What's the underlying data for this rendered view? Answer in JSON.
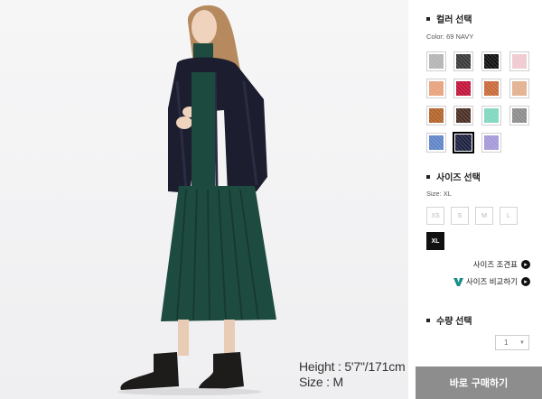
{
  "photo": {
    "caption_height": "Height : 5'7\"/171cm",
    "caption_size": "Size : M"
  },
  "color_section": {
    "title": "컬러 선택",
    "selected_label": "Color: 69 NAVY",
    "swatches": [
      {
        "name": "light-gray",
        "color": "#b4b4b4",
        "selected": false
      },
      {
        "name": "dark-gray",
        "color": "#3a3a3a",
        "selected": false
      },
      {
        "name": "black",
        "color": "#111111",
        "selected": false
      },
      {
        "name": "light-pink",
        "color": "#f0c9cf",
        "selected": false
      },
      {
        "name": "peach",
        "color": "#e7a27c",
        "selected": false
      },
      {
        "name": "red",
        "color": "#c2143a",
        "selected": false
      },
      {
        "name": "orange-brown",
        "color": "#c86a3a",
        "selected": false
      },
      {
        "name": "beige",
        "color": "#e2b08e",
        "selected": false
      },
      {
        "name": "brown",
        "color": "#b2642a",
        "selected": false
      },
      {
        "name": "dark-brown",
        "color": "#4a2f24",
        "selected": false
      },
      {
        "name": "mint",
        "color": "#7fd7be",
        "selected": false
      },
      {
        "name": "gray",
        "color": "#8c8c8c",
        "selected": false
      },
      {
        "name": "blue",
        "color": "#5f85c8",
        "selected": false
      },
      {
        "name": "navy",
        "color": "#1d2140",
        "selected": true
      },
      {
        "name": "lavender",
        "color": "#a598d8",
        "selected": false
      }
    ]
  },
  "size_section": {
    "title": "사이즈 선택",
    "selected_label": "Size: XL",
    "sizes": [
      {
        "label": "XS",
        "active": false
      },
      {
        "label": "S",
        "active": false
      },
      {
        "label": "M",
        "active": false
      },
      {
        "label": "L",
        "active": false
      },
      {
        "label": "XL",
        "active": true
      }
    ],
    "size_chart_link": "사이즈 조견표",
    "size_compare_link": "사이즈 비교하기"
  },
  "quantity_section": {
    "title": "수량 선택",
    "value": "1"
  },
  "buy_button": "바로 구매하기"
}
